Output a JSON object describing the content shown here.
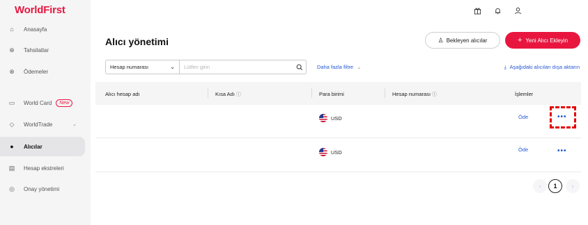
{
  "brand": {
    "logo": "WorldFirst",
    "accent": "#e8163f",
    "link_color": "#2458d3"
  },
  "sidebar": {
    "items": [
      {
        "label": "Anasayfa",
        "icon": "home-icon",
        "glyph": "⌂"
      },
      {
        "label": "Tahsilatlar",
        "icon": "collect-icon",
        "glyph": "⊕"
      },
      {
        "label": "Ödemeler",
        "icon": "payments-icon",
        "glyph": "⊗"
      },
      {
        "label": "World Card",
        "icon": "card-icon",
        "glyph": "▭",
        "badge": "New"
      },
      {
        "label": "WorldTrade",
        "icon": "shield-icon",
        "glyph": "◇"
      },
      {
        "label": "Alıcılar",
        "icon": "person-icon",
        "glyph": "●",
        "active": true
      },
      {
        "label": "Hesap ekstreleri",
        "icon": "statement-icon",
        "glyph": "▤"
      },
      {
        "label": "Onay yönetimi",
        "icon": "approval-icon",
        "glyph": "◎"
      }
    ]
  },
  "topbar": {
    "icons": [
      "gift-icon",
      "bell-icon",
      "user-icon"
    ]
  },
  "page": {
    "title": "Alıcı yönetimi",
    "pending_button": "Bekleyen alıcılar",
    "add_button": "Yeni Alıcı Ekleyin",
    "search": {
      "field": "Hesap numarası",
      "placeholder": "Lütfen girin"
    },
    "more_filter": "Daha fazla filtre",
    "export": "Aşağıdaki alıcıları dışa aktarın"
  },
  "table": {
    "columns": [
      "Alıcı hesap adı",
      "Kısa Adı",
      "Para birimi",
      "Hesap numarası",
      "İşlemler"
    ],
    "rows": [
      {
        "account_name": "",
        "short_name": "",
        "currency": "USD",
        "account_number": "",
        "action": "Öde",
        "more": "•••"
      },
      {
        "account_name": "",
        "short_name": "",
        "currency": "USD",
        "account_number": "",
        "action": "Öde",
        "more": "•••"
      }
    ]
  },
  "pagination": {
    "prev": "‹",
    "current": "1",
    "next": "›"
  }
}
